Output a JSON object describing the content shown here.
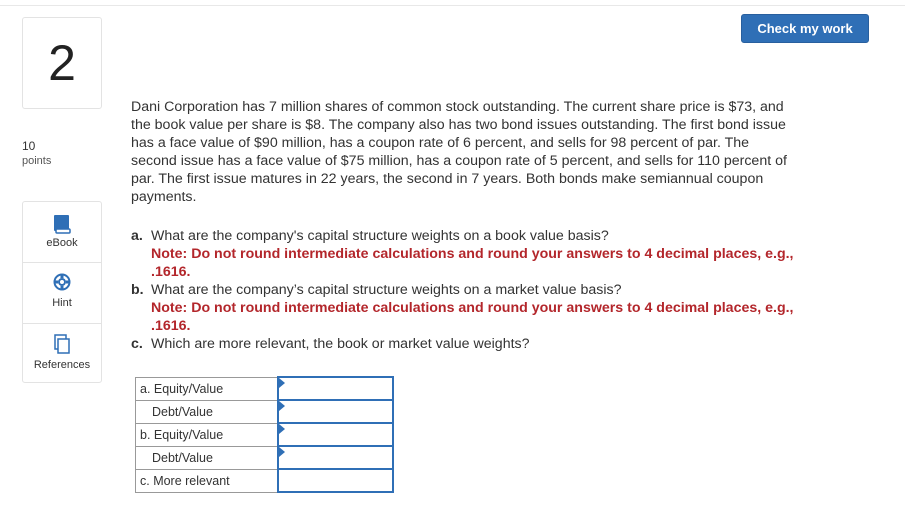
{
  "header": {
    "check_button": "Check my work"
  },
  "question": {
    "number": "2",
    "points_value": "10",
    "points_label": "points"
  },
  "tools": [
    {
      "label": "eBook",
      "icon": "book-icon"
    },
    {
      "label": "Hint",
      "icon": "lifebuoy-icon"
    },
    {
      "label": "References",
      "icon": "documents-icon"
    }
  ],
  "stem": [
    "Dani Corporation has 7 million shares of common stock outstanding. The current share price is $73, and",
    "the book value per share is $8. The company also has two bond issues outstanding. The first bond issue",
    "has a face value of $90 million, has a coupon rate of 6 percent, and sells for 98 percent of par. The",
    "second issue has a face value of $75 million, has a coupon rate of 5 percent, and sells for 110 percent of",
    "par. The first issue matures in 22 years, the second in 7 years. Both bonds make semiannual coupon",
    "payments."
  ],
  "parts": [
    {
      "letter": "a.",
      "text": "What are the company's capital structure weights on a book value basis?",
      "note1": "Note: Do not round intermediate calculations and round your answers to 4 decimal places, e.g.,",
      "note2": ".1616."
    },
    {
      "letter": "b.",
      "text": "What are the company’s capital structure weights on a market value basis?",
      "note1": "Note: Do not round intermediate calculations and round your answers to 4 decimal places, e.g.,",
      "note2": ".1616."
    },
    {
      "letter": "c.",
      "text": "Which are more relevant, the book or market value weights?"
    }
  ],
  "answer_rows": [
    {
      "label": "a. Equity/Value",
      "value": ""
    },
    {
      "label": "Debt/Value",
      "value": ""
    },
    {
      "label": "b. Equity/Value",
      "value": ""
    },
    {
      "label": "Debt/Value",
      "value": ""
    },
    {
      "label": "c. More relevant",
      "value": ""
    }
  ],
  "colors": {
    "accent": "#2f6fb6",
    "note": "#b3262b"
  }
}
